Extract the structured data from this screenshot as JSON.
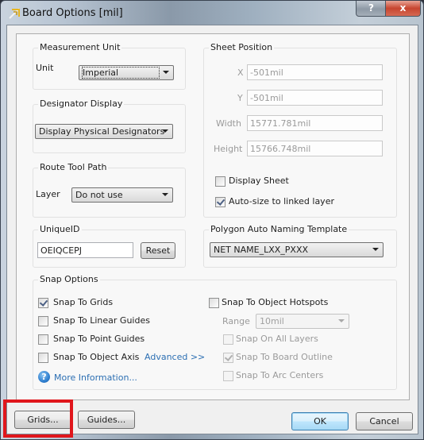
{
  "window": {
    "title": "Board Options [mil]",
    "help_label": "?",
    "close_label": "x"
  },
  "measurement_unit": {
    "group_label": "Measurement Unit",
    "unit_label": "Unit",
    "unit_value": "Imperial"
  },
  "designator_display": {
    "group_label": "Designator Display",
    "value": "Display Physical Designators"
  },
  "route_tool_path": {
    "group_label": "Route Tool Path",
    "layer_label": "Layer",
    "layer_value": "Do not use"
  },
  "unique_id": {
    "group_label": "UniqueID",
    "value": "OEIQCEPJ",
    "reset_label": "Reset"
  },
  "sheet_position": {
    "group_label": "Sheet Position",
    "x_label": "X",
    "x_value": "-501mil",
    "y_label": "Y",
    "y_value": "-501mil",
    "width_label": "Width",
    "width_value": "15771.781mil",
    "height_label": "Height",
    "height_value": "15766.748mil",
    "display_sheet_label": "Display Sheet",
    "display_sheet_checked": false,
    "autosize_label": "Auto-size to linked layer",
    "autosize_checked": true
  },
  "polygon_naming": {
    "group_label": "Polygon Auto Naming Template",
    "value": "NET NAME_LXX_PXXX"
  },
  "snap_options": {
    "group_label": "Snap Options",
    "snap_to_grids": "Snap To Grids",
    "snap_to_grids_checked": true,
    "snap_to_linear_guides": "Snap To Linear Guides",
    "snap_to_point_guides": "Snap To Point Guides",
    "snap_to_object_axis": "Snap To Object Axis",
    "advanced_link": "Advanced >>",
    "more_info_link": "More Information...",
    "snap_to_object_hotspots": "Snap To Object Hotspots",
    "range_label": "Range",
    "range_value": "10mil",
    "snap_on_all_layers": "Snap On All Layers",
    "snap_to_board_outline": "Snap To Board Outline",
    "snap_to_board_outline_checked": true,
    "snap_to_arc_centers": "Snap To Arc Centers"
  },
  "footer": {
    "grids_label": "Grids...",
    "guides_label": "Guides...",
    "ok_label": "OK",
    "cancel_label": "Cancel"
  },
  "colors": {
    "highlight": "#e0161c",
    "link": "#2c6fb3"
  }
}
